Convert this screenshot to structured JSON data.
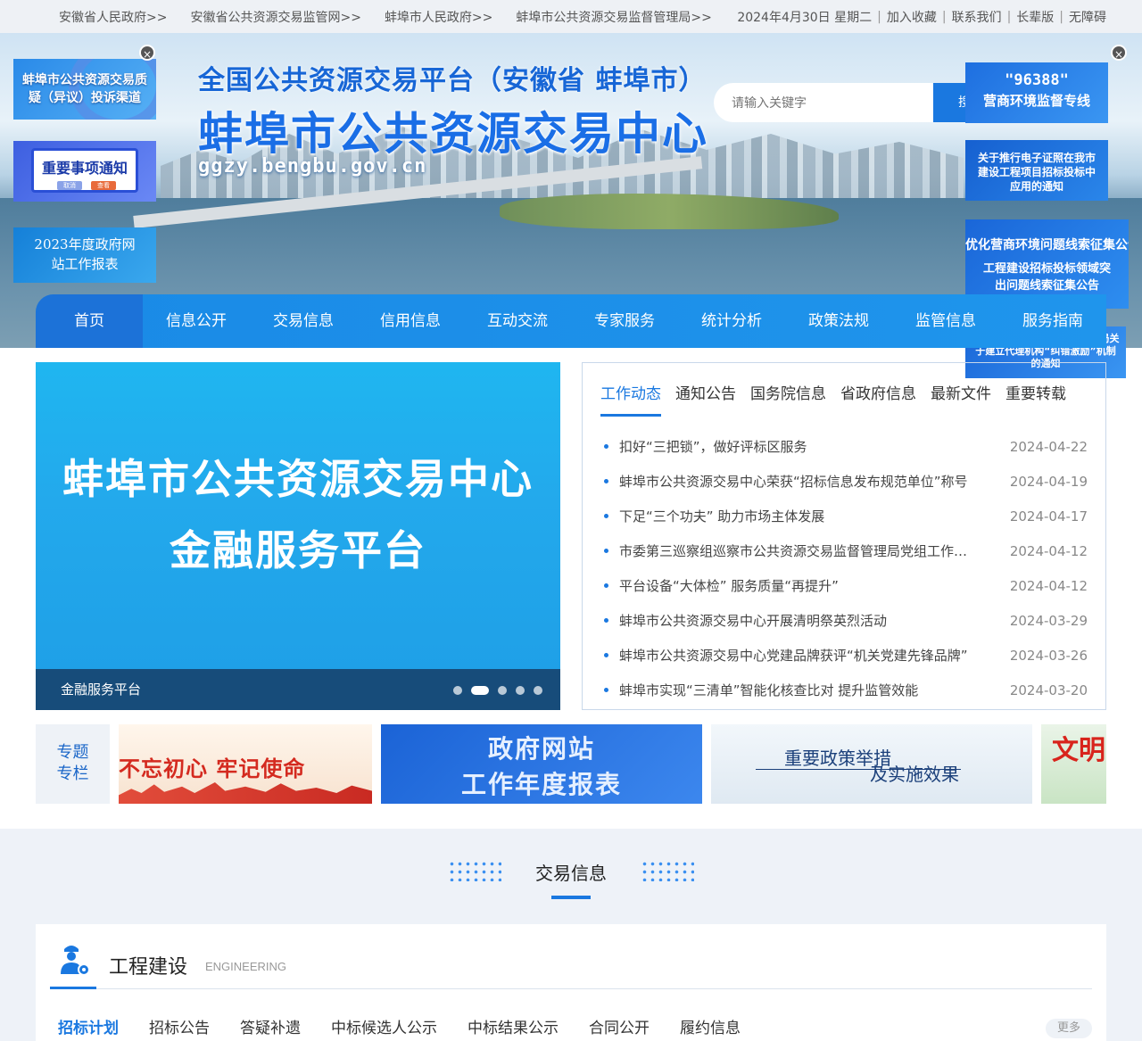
{
  "topbar": {
    "links": [
      "安徽省人民政府>>",
      "安徽省公共资源交易监管网>>",
      "蚌埠市人民政府>>",
      "蚌埠市公共资源交易监督管理局>>"
    ],
    "date": "2024年4月30日 星期二",
    "actions": [
      "加入收藏",
      "联系我们",
      "长辈版",
      "无障碍"
    ]
  },
  "header": {
    "title1": "全国公共资源交易平台（安徽省 蚌埠市）",
    "title2": "蚌埠市公共资源交易中心",
    "url": "ggzy.bengbu.gov.cn",
    "search_placeholder": "请输入关键字",
    "search_button": "搜"
  },
  "floats": {
    "left1": "蚌埠市公共资源交易质疑（异议）投诉渠道",
    "left2": "重要事项通知",
    "left2_btn1": "取消",
    "left2_btn2": "查看",
    "left3": "2023年度政府网站工作报表",
    "right1_a": "\"96388\"",
    "right1_b": "营商环境监督专线",
    "right2": "关于推行电子证照在我市建设工程项目招标投标中应用的通知",
    "right3_a": "优化营商环境问题线索征集公告",
    "right3_b": "工程建设招标投标领域突出问题线索征集公告",
    "right4": "蚌埠市公共资源交易监督管理局关于建立代理机构“纠错激励”机制的通知",
    "close": "×"
  },
  "nav": [
    "首页",
    "信息公开",
    "交易信息",
    "信用信息",
    "互动交流",
    "专家服务",
    "统计分析",
    "政策法规",
    "监管信息",
    "服务指南"
  ],
  "slider": {
    "line1": "蚌埠市公共资源交易中心",
    "line2": "金融服务平台",
    "caption": "金融服务平台",
    "slide_count": 5,
    "active_slide": 2
  },
  "news": {
    "tabs": [
      "工作动态",
      "通知公告",
      "国务院信息",
      "省政府信息",
      "最新文件",
      "重要转载"
    ],
    "items": [
      {
        "title": "扣好“三把锁”，做好评标区服务",
        "date": "2024-04-22"
      },
      {
        "title": "蚌埠市公共资源交易中心荣获“招标信息发布规范单位”称号",
        "date": "2024-04-19"
      },
      {
        "title": "下足“三个功夫” 助力市场主体发展",
        "date": "2024-04-17"
      },
      {
        "title": "市委第三巡察组巡察市公共资源交易监督管理局党组工作动员会召开",
        "date": "2024-04-12"
      },
      {
        "title": "平台设备“大体检” 服务质量“再提升”",
        "date": "2024-04-12"
      },
      {
        "title": "蚌埠市公共资源交易中心开展清明祭英烈活动",
        "date": "2024-03-29"
      },
      {
        "title": "蚌埠市公共资源交易中心党建品牌获评“机关党建先锋品牌”",
        "date": "2024-03-26"
      },
      {
        "title": "蚌埠市实现“三清单”智能化核查比对 提升监管效能",
        "date": "2024-03-20"
      }
    ]
  },
  "special": {
    "label": "专题专栏",
    "b1": "不忘初心 牢记使命",
    "b2_a": "政府网站",
    "b2_b": "工作年度报表",
    "b3_a": "重要政策举措",
    "b3_b": "及实施效果",
    "b4": "文明"
  },
  "trade": {
    "title": "交易信息",
    "card_title": "工程建设",
    "card_en": "ENGINEERING",
    "subtabs": [
      "招标计划",
      "招标公告",
      "答疑补遗",
      "中标候选人公示",
      "中标结果公示",
      "合同公开",
      "履约信息"
    ],
    "more": "更多"
  }
}
